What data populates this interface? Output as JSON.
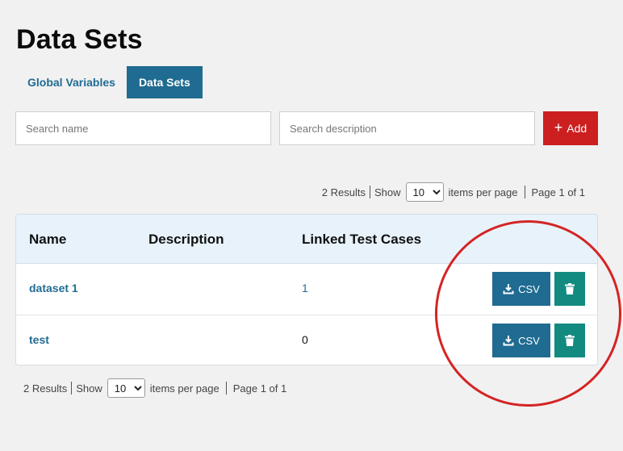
{
  "page": {
    "title": "Data Sets"
  },
  "tabs": [
    {
      "label": "Global Variables",
      "active": false
    },
    {
      "label": "Data Sets",
      "active": true
    }
  ],
  "filters": {
    "name_placeholder": "Search name",
    "description_placeholder": "Search description",
    "add_label": "Add",
    "add_icon": "plus-icon"
  },
  "pagination": {
    "results": "2 Results",
    "show_label": "Show",
    "page_size": "10",
    "page_size_options": [
      "10"
    ],
    "items_per_page_label": "items per page",
    "page_label": "Page 1 of 1"
  },
  "table": {
    "headers": {
      "name": "Name",
      "description": "Description",
      "linked": "Linked Test Cases"
    },
    "rows": [
      {
        "name": "dataset 1",
        "description": "",
        "linked": "1",
        "csv_label": "CSV"
      },
      {
        "name": "test",
        "description": "",
        "linked": "0",
        "csv_label": "CSV"
      }
    ]
  },
  "colors": {
    "primary": "#1f6b91",
    "danger": "#cc1f1f",
    "delete": "#138a80",
    "annotation": "#d42424"
  }
}
